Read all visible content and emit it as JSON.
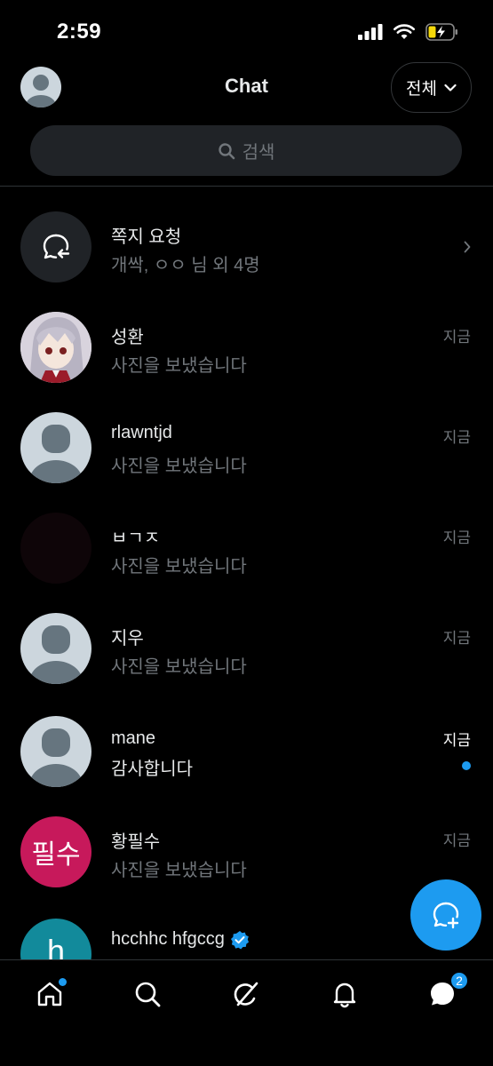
{
  "status_bar": {
    "time": "2:59"
  },
  "header": {
    "title": "Chat",
    "filter_label": "전체"
  },
  "search": {
    "label": "검색"
  },
  "message_requests": {
    "title": "쪽지 요청",
    "subtitle": "개싹, ㅇㅇ 님 외 4명"
  },
  "chats": [
    {
      "name": "성환",
      "preview": "사진을 보냈습니다",
      "time": "지금"
    },
    {
      "name": "rlawntjd",
      "preview": "사진을 보냈습니다",
      "time": "지금"
    },
    {
      "name": "ㅂㄱㅈ",
      "preview": "사진을 보냈습니다",
      "time": "지금"
    },
    {
      "name": "지우",
      "preview": "사진을 보냈습니다",
      "time": "지금"
    },
    {
      "name": "mane",
      "preview": "감사합니다",
      "time": "지금",
      "unread": true
    },
    {
      "name": "황필수",
      "preview": "사진을 보냈습니다",
      "time": "지금",
      "avatar_text": "필수"
    },
    {
      "name": "hcchhc hfgccg",
      "preview": "",
      "time": "",
      "avatar_text": "h",
      "verified": true
    }
  ],
  "bottom_nav": {
    "messages_badge": "2"
  },
  "colors": {
    "accent": "#1d9bf0",
    "avatar_pink": "#c7195b",
    "avatar_teal": "#128a9b"
  }
}
